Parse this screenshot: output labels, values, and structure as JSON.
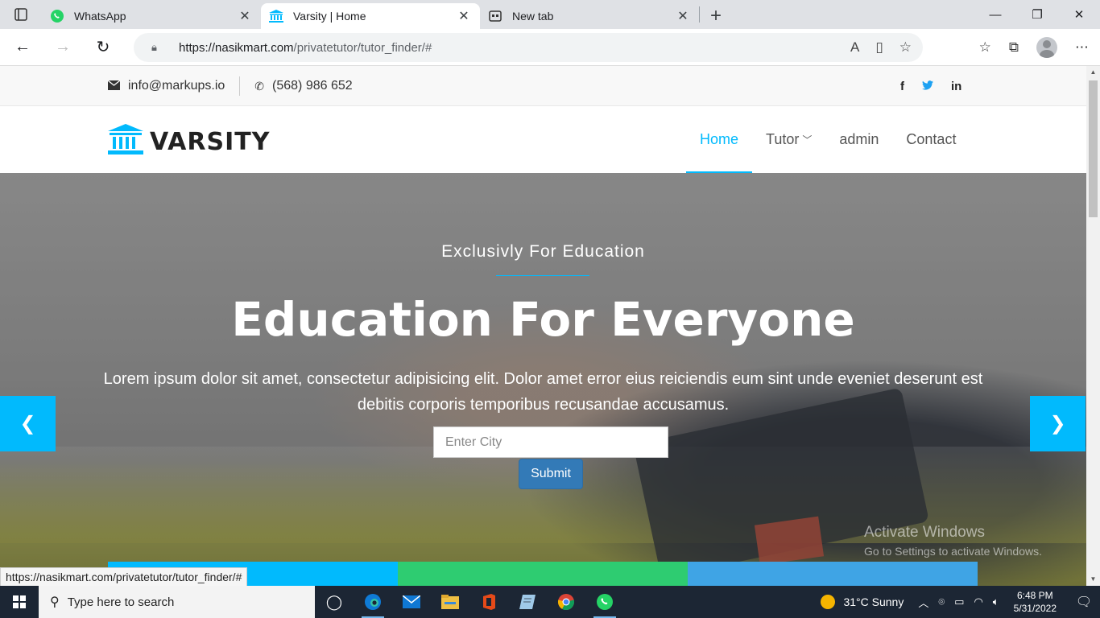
{
  "browser": {
    "tabs": [
      {
        "title": "WhatsApp",
        "icon": "whatsapp-icon",
        "active": false
      },
      {
        "title": "Varsity | Home",
        "icon": "institution-icon",
        "active": true
      },
      {
        "title": "New tab",
        "icon": "newtab-icon",
        "active": false
      }
    ],
    "url_domain": "https://nasikmart.com",
    "url_path": "/privatetutor/tutor_finder/#"
  },
  "topbar": {
    "email": "info@markups.io",
    "phone": "(568) 986 652",
    "socials": [
      "f",
      "t",
      "in"
    ]
  },
  "header": {
    "brand": "VARSITY",
    "nav": [
      {
        "label": "Home",
        "active": true
      },
      {
        "label": "Tutor",
        "dropdown": true
      },
      {
        "label": "admin"
      },
      {
        "label": "Contact"
      }
    ]
  },
  "hero": {
    "subtitle": "Exclusivly For Education",
    "title": "Education For Everyone",
    "text": "Lorem ipsum dolor sit amet, consectetur adipisicing elit. Dolor amet error eius reiciendis eum sint unde eveniet deserunt est debitis corporis temporibus recusandae accusamus.",
    "city_placeholder": "Enter City",
    "submit_label": "Submit"
  },
  "feature_colors": [
    "#01bafd",
    "#2ecc71",
    "#3fa4e5"
  ],
  "watermark": {
    "line1": "Activate Windows",
    "line2": "Go to Settings to activate Windows."
  },
  "status_url": "https://nasikmart.com/privatetutor/tutor_finder/#",
  "taskbar": {
    "search_placeholder": "Type here to search",
    "weather": "31°C  Sunny",
    "time": "6:48 PM",
    "date": "5/31/2022"
  },
  "colors": {
    "accent": "#01bafd",
    "submit": "#337ab7",
    "taskbar": "#1c2634"
  }
}
